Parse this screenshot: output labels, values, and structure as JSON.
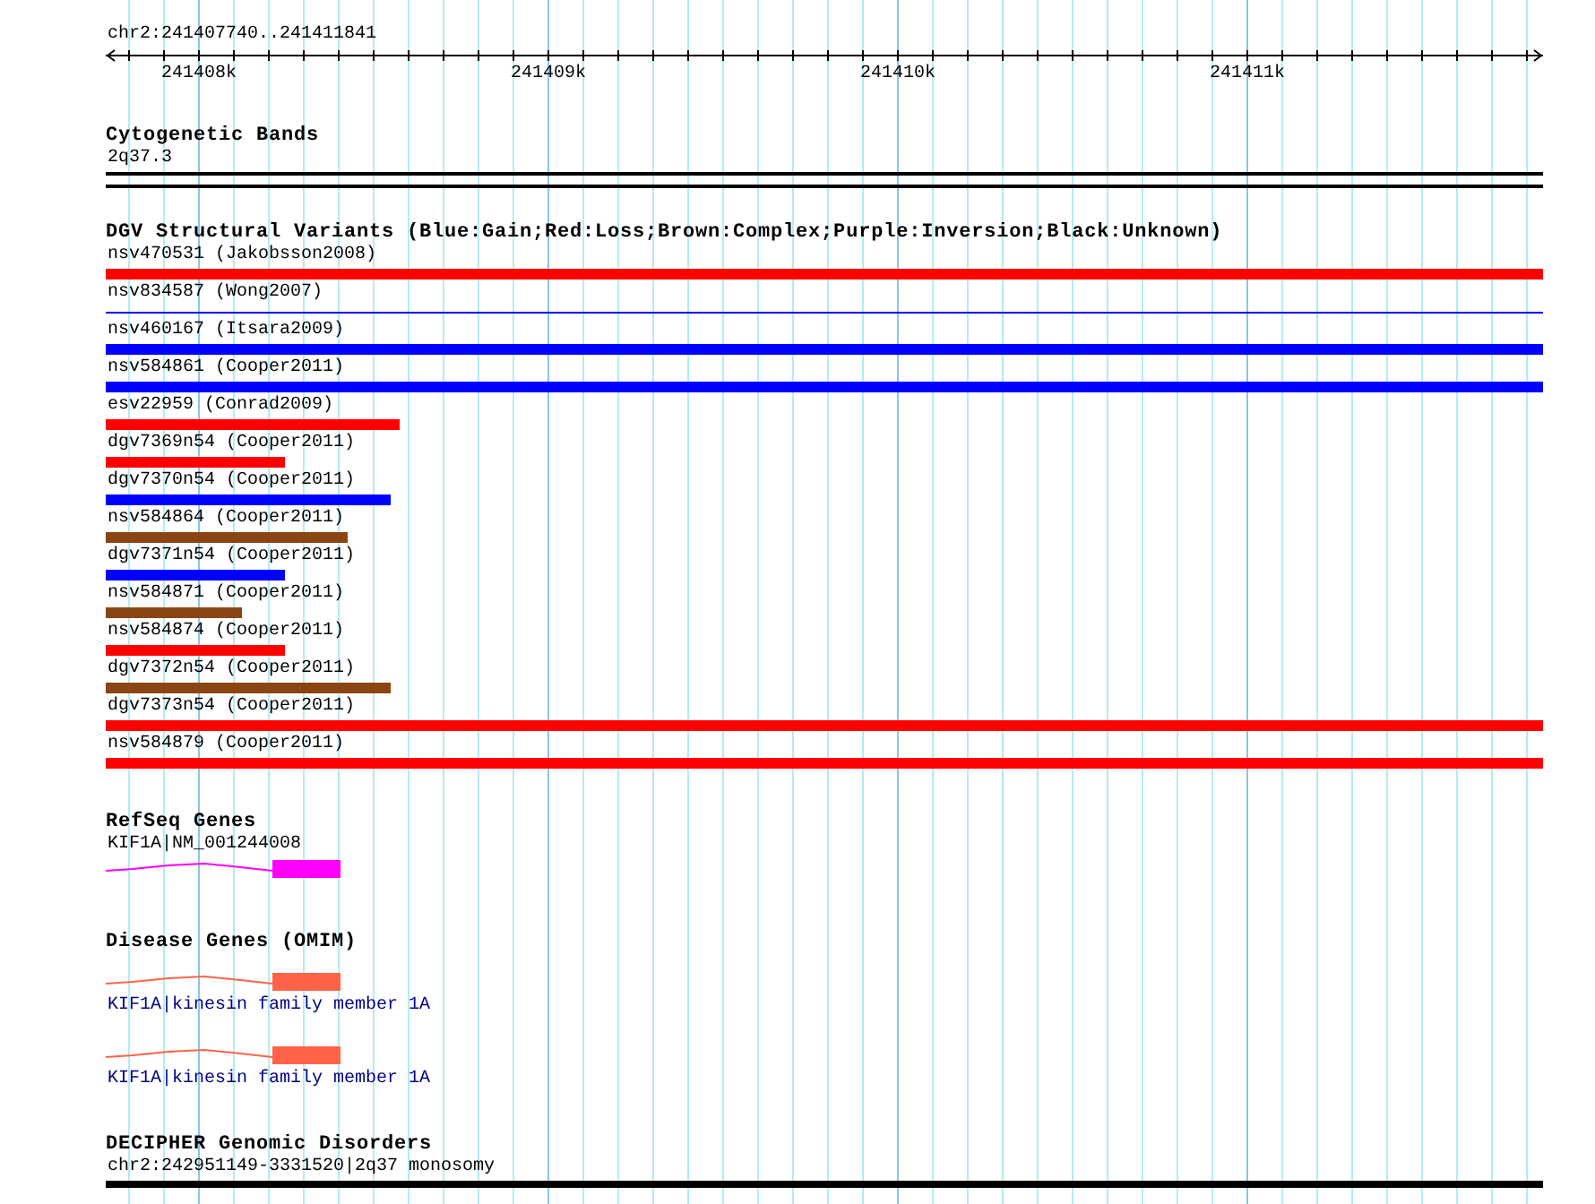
{
  "ruler": {
    "range": "chr2:241407740..241411841",
    "ticks": [
      "241408k",
      "241409k",
      "241410k",
      "241411k"
    ]
  },
  "cytogenetic_bands": {
    "title": "Cytogenetic Bands",
    "features": [
      {
        "name": "2q37.3"
      }
    ]
  },
  "dgv": {
    "title": "DGV Structural Variants (Blue:Gain;Red:Loss;Brown:Complex;Purple:Inversion;Black:Unknown)",
    "variants": [
      {
        "name": "nsv470531 (Jakobsson2008)",
        "kind": "bar",
        "color": "#ff0000"
      },
      {
        "name": "nsv834587 (Wong2007)",
        "kind": "line",
        "color": "#0000ff"
      },
      {
        "name": "nsv460167 (Itsara2009)",
        "kind": "bar",
        "color": "#0000ff"
      },
      {
        "name": "nsv584861 (Cooper2011)",
        "kind": "bar",
        "color": "#0000ff"
      },
      {
        "name": "esv22959 (Conrad2009)",
        "kind": "bar",
        "color": "#ff0000",
        "level": 0.204
      },
      {
        "name": "dgv7369n54 (Cooper2011)",
        "kind": "bar",
        "color": "#ff0000",
        "level": 0.125
      },
      {
        "name": "dgv7370n54 (Cooper2011)",
        "kind": "bar",
        "color": "#0000ff",
        "level": 0.198
      },
      {
        "name": "nsv584864 (Cooper2011)",
        "kind": "bar",
        "color": "#8b4513",
        "level": 0.168
      },
      {
        "name": "dgv7371n54 (Cooper2011)",
        "kind": "bar",
        "color": "#0000ff",
        "level": 0.125
      },
      {
        "name": "nsv584871 (Cooper2011)",
        "kind": "bar",
        "color": "#8b4513",
        "level": 0.095
      },
      {
        "name": "nsv584874 (Cooper2011)",
        "kind": "bar",
        "color": "#ff0000",
        "level": 0.125
      },
      {
        "name": "dgv7372n54 (Cooper2011)",
        "kind": "bar",
        "color": "#8b4513",
        "level": 0.198
      },
      {
        "name": "dgv7373n54 (Cooper2011)",
        "kind": "bar",
        "color": "#ff0000"
      },
      {
        "name": "nsv584879 (Cooper2011)",
        "kind": "bar",
        "color": "#ff0000"
      }
    ]
  },
  "refseq": {
    "title": "RefSeq Genes",
    "genes": [
      {
        "name": "KIF1A|NM_001244008"
      }
    ]
  },
  "disease_genes": {
    "title": "Disease Genes (OMIM)",
    "genes": [
      {
        "name": "KIF1A|kinesin family member 1A"
      },
      {
        "name": "KIF1A|kinesin family member 1A"
      }
    ]
  },
  "decipher": {
    "title": "DECIPHER Genomic Disorders",
    "features": [
      {
        "name": "chr2:242951149-3331520|2q37 monosomy"
      }
    ]
  }
}
